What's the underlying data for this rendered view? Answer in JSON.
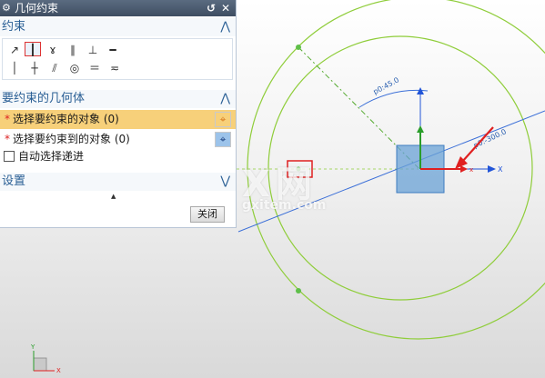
{
  "dialog": {
    "title": "几何约束",
    "section_constraints": "约束",
    "section_geometry": "要约束的几何体",
    "section_settings": "设置",
    "select_object_label": "选择要约束的对象 (0)",
    "select_target_label": "选择要约束到的对象 (0)",
    "auto_select_label": "自动选择递进",
    "close_label": "关闭",
    "required_marker": "*",
    "constraint_icons": [
      "coincident-icon",
      "point-on-curve-icon",
      "tangent-icon",
      "parallel-icon",
      "perpendicular-icon",
      "horizontal-icon",
      "vertical-icon",
      "midpoint-icon",
      "collinear-icon",
      "concentric-icon",
      "equal-length-icon",
      "equal-radius-icon"
    ],
    "selected_icon": "point-on-curve-icon"
  },
  "canvas": {
    "dim_radius_label": "p0:45.0",
    "dim_angle_label": "p0:-300.0",
    "axis_x_label": "X",
    "axis_y_label": "Y",
    "colors": {
      "circle": "#8fcd3a",
      "axis": "#2255d8",
      "highlight": "#e02020",
      "square": "#6aa2d6"
    }
  },
  "watermark": {
    "main": "X网",
    "sub": "gxitem.com"
  }
}
